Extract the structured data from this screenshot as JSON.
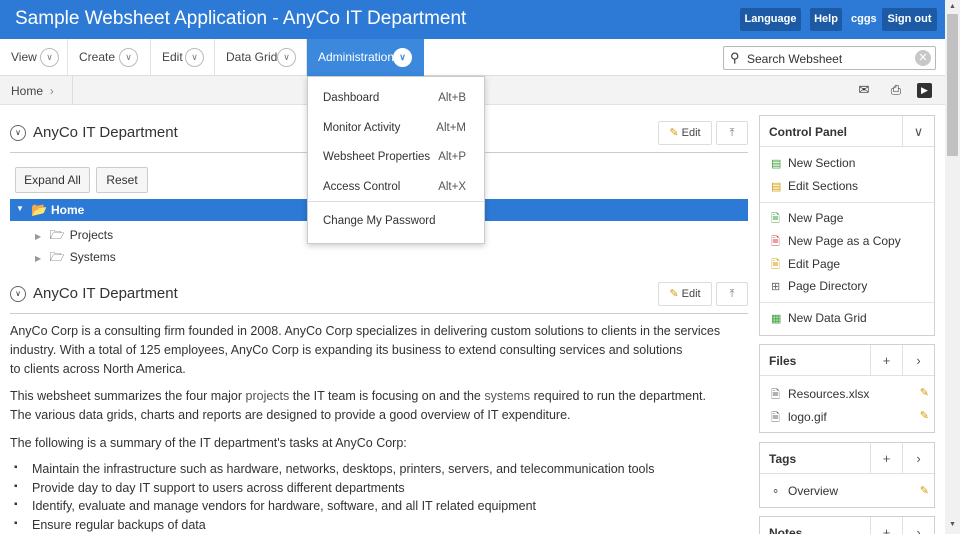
{
  "header": {
    "title": "Sample Websheet Application - AnyCo IT Department",
    "language": "Language",
    "help": "Help",
    "user": "cggs",
    "signout": "Sign out"
  },
  "nav": {
    "view": "View",
    "create": "Create",
    "edit": "Edit",
    "data_grid": "Data Grid",
    "administration": "Administration",
    "search_placeholder": "Search Websheet"
  },
  "breadcrumb": {
    "home": "Home"
  },
  "admin_menu": [
    {
      "label": "Dashboard",
      "accel": "Alt+B"
    },
    {
      "label": "Monitor Activity",
      "accel": "Alt+M"
    },
    {
      "label": "Websheet Properties",
      "accel": "Alt+P"
    },
    {
      "label": "Access Control",
      "accel": "Alt+X"
    },
    {
      "label": "Change My Password",
      "accel": ""
    }
  ],
  "section1": {
    "title": "AnyCo IT Department",
    "edit": "Edit",
    "expand_all": "Expand All",
    "reset": "Reset"
  },
  "tree": {
    "root": "Home",
    "children": [
      "Projects",
      "Systems"
    ]
  },
  "section2": {
    "title": "AnyCo IT Department",
    "edit": "Edit",
    "p1_l1": "AnyCo Corp is a consulting firm founded in 2008. AnyCo Corp specializes in delivering custom solutions to clients in the services",
    "p1_l2": "industry. With a total of 125 employees, AnyCo Corp is expanding its business to extend consulting services and solutions",
    "p1_l3": "to clients across North America.",
    "p2_a": "This websheet summarizes the four major ",
    "p2_link1": "projects",
    "p2_b": " the IT team is focusing on and the ",
    "p2_link2": "systems",
    "p2_c": " required to run the department.",
    "p2_l2": "The various data grids, charts and reports are designed to provide a good overview of IT expenditure.",
    "p3": "The following is a summary of the IT department's tasks at AnyCo Corp:",
    "bullets": [
      "Maintain the infrastructure such as hardware, networks, desktops, printers, servers, and telecommunication tools",
      "Provide day to day IT support to users across different departments",
      "Identify, evaluate and manage vendors for hardware, software, and all IT related equipment",
      "Ensure regular backups of data"
    ]
  },
  "control_panel": {
    "title": "Control Panel",
    "items": [
      "New Section",
      "Edit Sections",
      "New Page",
      "New Page as a Copy",
      "Edit Page",
      "Page Directory",
      "New Data Grid"
    ]
  },
  "files": {
    "title": "Files",
    "items": [
      "Resources.xlsx",
      "logo.gif"
    ]
  },
  "tags": {
    "title": "Tags",
    "items": [
      "Overview"
    ]
  },
  "notes": {
    "title": "Notes"
  }
}
